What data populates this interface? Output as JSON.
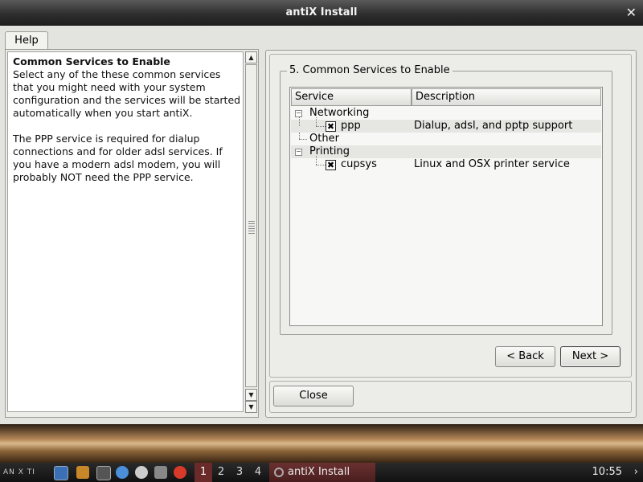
{
  "window": {
    "title": "antiX Install",
    "close_glyph": "✕"
  },
  "help": {
    "tab_label": "Help",
    "heading": "Common Services to Enable",
    "paragraph1": "Select any of the these common services that you might need with your system configuration and the services will be started automatically when you start antiX.",
    "paragraph2": "The PPP service is required for dialup connections and for older adsl services. If you have a modern adsl modem, you will probably NOT need the PPP service."
  },
  "services": {
    "group_title": "5. Common Services to Enable",
    "columns": [
      "Service",
      "Description"
    ],
    "categories": [
      {
        "name": "Networking",
        "items": [
          {
            "name": "ppp",
            "checked": true,
            "description": "Dialup, adsl, and pptp support"
          }
        ]
      },
      {
        "name": "Other",
        "items": []
      },
      {
        "name": "Printing",
        "items": [
          {
            "name": "cupsys",
            "checked": true,
            "description": "Linux and OSX printer service"
          }
        ]
      }
    ]
  },
  "buttons": {
    "back": "< Back",
    "next": "Next >",
    "close": "Close"
  },
  "taskbar": {
    "logo_text": "AN X TI",
    "workspaces": [
      "1",
      "2",
      "3",
      "4"
    ],
    "active_workspace": "1",
    "task_label": "antiX Install",
    "clock": "10:55",
    "tray_arrow": "›",
    "icons": [
      "desktop-icon",
      "folder-icon",
      "terminal-icon",
      "browser-icon",
      "mount-icon",
      "settings-icon",
      "power-icon"
    ]
  },
  "colors": {
    "accent": "#6a2a2a",
    "titlebar": "#2e2e2e"
  }
}
